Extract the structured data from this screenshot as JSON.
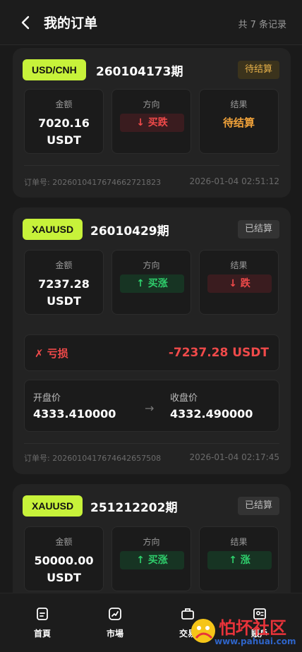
{
  "header": {
    "title": "我的订单",
    "count": "共 7 条记录"
  },
  "labels": {
    "amount": "金额",
    "direction": "方向",
    "result": "结果",
    "order_no_prefix": "订单号: ",
    "open_price": "开盘价",
    "close_price": "收盘价",
    "arrow": "→"
  },
  "orders": [
    {
      "symbol": "USD/CNH",
      "period": "260104173期",
      "status": "待结算",
      "amount": "7020.16",
      "unit": "USDT",
      "direction": "↓ 买跌",
      "result": "待结算",
      "order_no": "订单号: 2026010417674662721823",
      "time": "2026-01-04 02:51:12"
    },
    {
      "symbol": "XAUUSD",
      "period": "26010429期",
      "status": "已结算",
      "amount": "7237.28",
      "unit": "USDT",
      "direction": "↑ 买涨",
      "result": "↓ 跌",
      "pnl_label": "✗ 亏损",
      "pnl_value": "-7237.28 USDT",
      "open_price": "4333.410000",
      "close_price": "4332.490000",
      "order_no": "订单号: 2026010417674642657508",
      "time": "2026-01-04 02:17:45"
    },
    {
      "symbol": "XAUUSD",
      "period": "251212202期",
      "status": "已结算",
      "amount": "50000.00",
      "unit": "USDT",
      "direction": "↑ 买涨",
      "result": "↑ 涨"
    }
  ],
  "tabbar": {
    "items": [
      {
        "label": "首頁",
        "icon": "home-doc-icon"
      },
      {
        "label": "市場",
        "icon": "market-chart-icon"
      },
      {
        "label": "交易",
        "icon": "trade-briefcase-icon"
      },
      {
        "label": "賬戶",
        "icon": "account-id-icon"
      }
    ]
  },
  "watermark": {
    "title": "怕坏社区",
    "url": "www.pahuai.com"
  },
  "colors": {
    "accent": "#c7f23a",
    "down": "#f04a4a",
    "up": "#2fcf6c",
    "pending": "#f0a23a",
    "background": "#1a1a1a",
    "card": "#232323"
  }
}
